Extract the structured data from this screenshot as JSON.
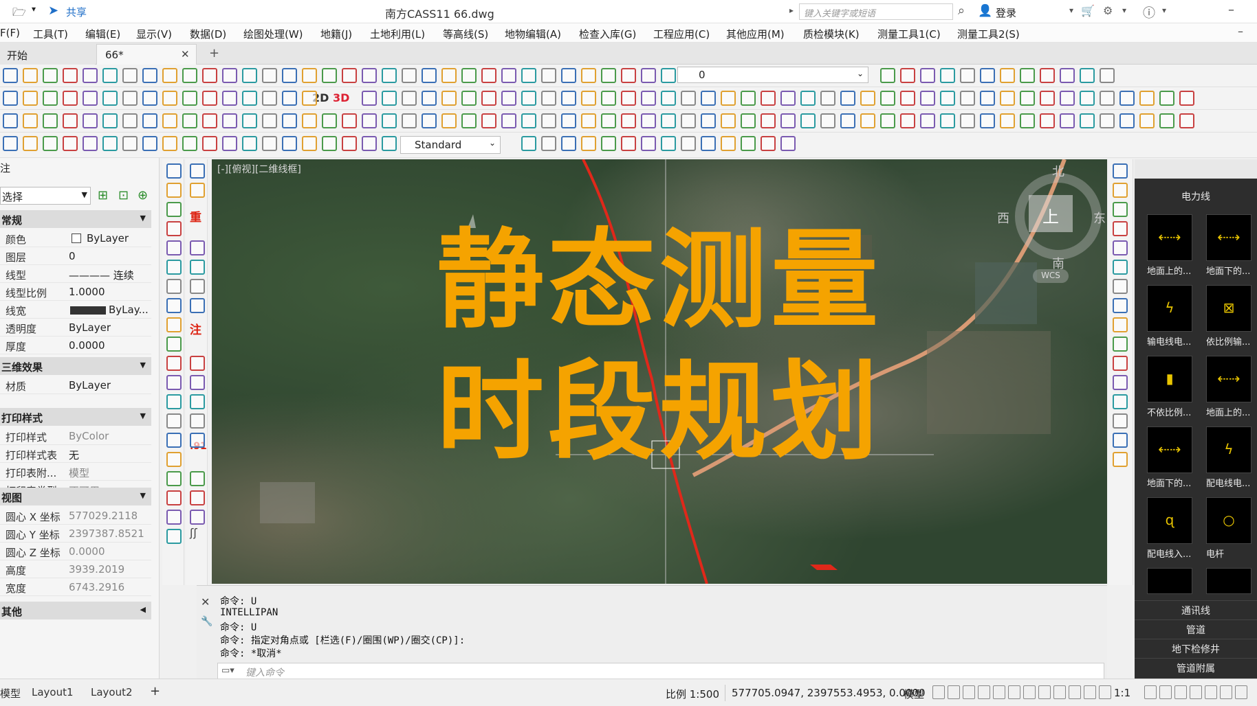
{
  "titlebar": {
    "share_label": "共享",
    "app_title": "南方CASS11    66.dwg",
    "search_placeholder": "键入关键字或短语",
    "login_label": "登录"
  },
  "menu": [
    "F(F)",
    "工具(T)",
    "编辑(E)",
    "显示(V)",
    "数据(D)",
    "绘图处理(W)",
    "地籍(J)",
    "土地利用(L)",
    "等高线(S)",
    "地物编辑(A)",
    "检查入库(G)",
    "工程应用(C)",
    "其他应用(M)",
    "质检模块(K)",
    "测量工具1(C)",
    "测量工具2(S)"
  ],
  "tabs": {
    "start": "开始",
    "doc": "66*",
    "close": "✕",
    "add": "+"
  },
  "toolbar": {
    "label_2d": "2D",
    "label_3d": "3D",
    "layer_value": "0",
    "style_value": "Standard"
  },
  "properties": {
    "header": "注",
    "selector": "选择",
    "sections": {
      "general": "常规",
      "effects3d": "三维效果",
      "plotstyle": "打印样式",
      "view": "视图",
      "misc": "其他"
    },
    "general": [
      {
        "k": "颜色",
        "v": "ByLayer"
      },
      {
        "k": "图层",
        "v": "0"
      },
      {
        "k": "线型",
        "v": "———— 连续"
      },
      {
        "k": "线型比例",
        "v": "1.0000"
      },
      {
        "k": "线宽",
        "v": "ByLay..."
      },
      {
        "k": "透明度",
        "v": "ByLayer"
      },
      {
        "k": "厚度",
        "v": "0.0000"
      }
    ],
    "effects3d": [
      {
        "k": "材质",
        "v": "ByLayer"
      }
    ],
    "plotstyle": [
      {
        "k": "打印样式",
        "v": "ByColor"
      },
      {
        "k": "打印样式表",
        "v": "无"
      },
      {
        "k": "打印表附...",
        "v": "模型"
      },
      {
        "k": "打印表类型",
        "v": "不可用"
      }
    ],
    "view": [
      {
        "k": "圆心 X 坐标",
        "v": "577029.2118"
      },
      {
        "k": "圆心 Y 坐标",
        "v": "2397387.8521"
      },
      {
        "k": "圆心 Z 坐标",
        "v": "0.0000"
      },
      {
        "k": "高度",
        "v": "3939.2019"
      },
      {
        "k": "宽度",
        "v": "6743.2916"
      }
    ]
  },
  "viewport": {
    "label": "[-][俯视][二维线框]",
    "overlay_line1": "静态测量",
    "overlay_line2": "时段规划",
    "compass": {
      "n": "北",
      "s": "南",
      "e": "东",
      "w": "西",
      "top": "上",
      "wcs": "WCS"
    }
  },
  "palette": {
    "title": "电力线",
    "tiles": [
      "地面上的...",
      "地面下的...",
      "输电线电...",
      "依比例输...",
      "不依比例...",
      "地面上的...",
      "地面下的...",
      "配电线电...",
      "配电线入...",
      "电杆"
    ],
    "list": [
      "通讯线",
      "管道",
      "地下检修井",
      "管道附属"
    ]
  },
  "command": {
    "lines": [
      "命令:  U",
      "INTELLIPAN",
      "命令:  U",
      "命令: 指定对角点或 [栏选(F)/圈围(WP)/圈交(CP)]:",
      "命令: *取消*"
    ],
    "placeholder": "键入命令"
  },
  "statusbar": {
    "layout_tabs": [
      "模型",
      "Layout1",
      "Layout2"
    ],
    "scale": "比例 1:500",
    "coords": "577705.0947, 2397553.4953, 0.0000",
    "model": "模型",
    "annot_scale": "1:1"
  },
  "colors": {
    "overlay": "#f5a300",
    "road": "#e0281a",
    "palette_bg": "#2d2d2d"
  }
}
